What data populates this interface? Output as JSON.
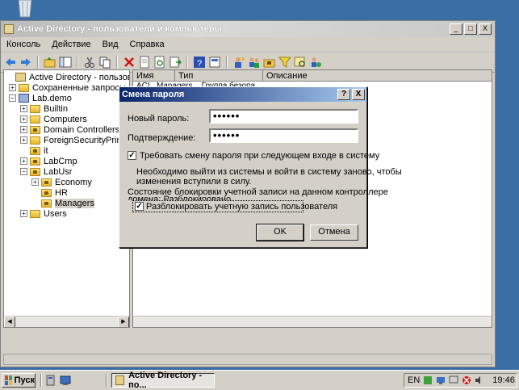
{
  "window": {
    "title": "Active Directory - пользователи и компьютеры",
    "controls": {
      "minimize": "_",
      "maximize": "□",
      "close": "X"
    }
  },
  "menu": [
    "Консоль",
    "Действие",
    "Вид",
    "Справка"
  ],
  "tree": {
    "root": "Active Directory - пользователи и",
    "saved_queries": "Сохраненные запросы",
    "domain": "Lab.demo",
    "items": {
      "builtin": "Builtin",
      "computers": "Computers",
      "domain_controllers": "Domain Controllers",
      "foreign": "ForeignSecurityPrincipal",
      "it": "it",
      "labcmp": "LabCmp",
      "labusr": "LabUsr",
      "economy": "Economy",
      "hr": "HR",
      "managers": "Managers",
      "users": "Users"
    }
  },
  "list": {
    "columns": [
      "Имя",
      "Тип",
      "Описание"
    ],
    "partial_row": "ACL_Managers...    Группа безопа..."
  },
  "dialog": {
    "title": "Смена пароля",
    "help_btn": "?",
    "close_btn": "X",
    "new_password_label": "Новый пароль:",
    "new_password_value": "••••••",
    "confirm_label": "Подтверждение:",
    "confirm_value": "••••••",
    "require_change_label": "Требовать смену пароля при следующем входе в систему",
    "require_change_checked": "✓",
    "note_line1": "Необходимо выйти из системы и войти в систему заново, чтобы",
    "note_line2": "изменения вступили в силу.",
    "lockout_line1": "Состояние блокировки учетной записи на данном контроллере",
    "lockout_line2": "домена: Разблокировано",
    "unlock_label": "Разблокировать учетную запись пользователя",
    "unlock_checked": "✓",
    "ok": "OK",
    "cancel": "Отмена"
  },
  "taskbar": {
    "start": "Пуск",
    "task": "Active Directory - по...",
    "lang": "EN",
    "time": "19:46"
  },
  "colors": {
    "desktop": "#3a6ea5",
    "dialog_title_start": "#0a246a",
    "dialog_title_end": "#a6caf0",
    "face": "#d4d0c8"
  }
}
